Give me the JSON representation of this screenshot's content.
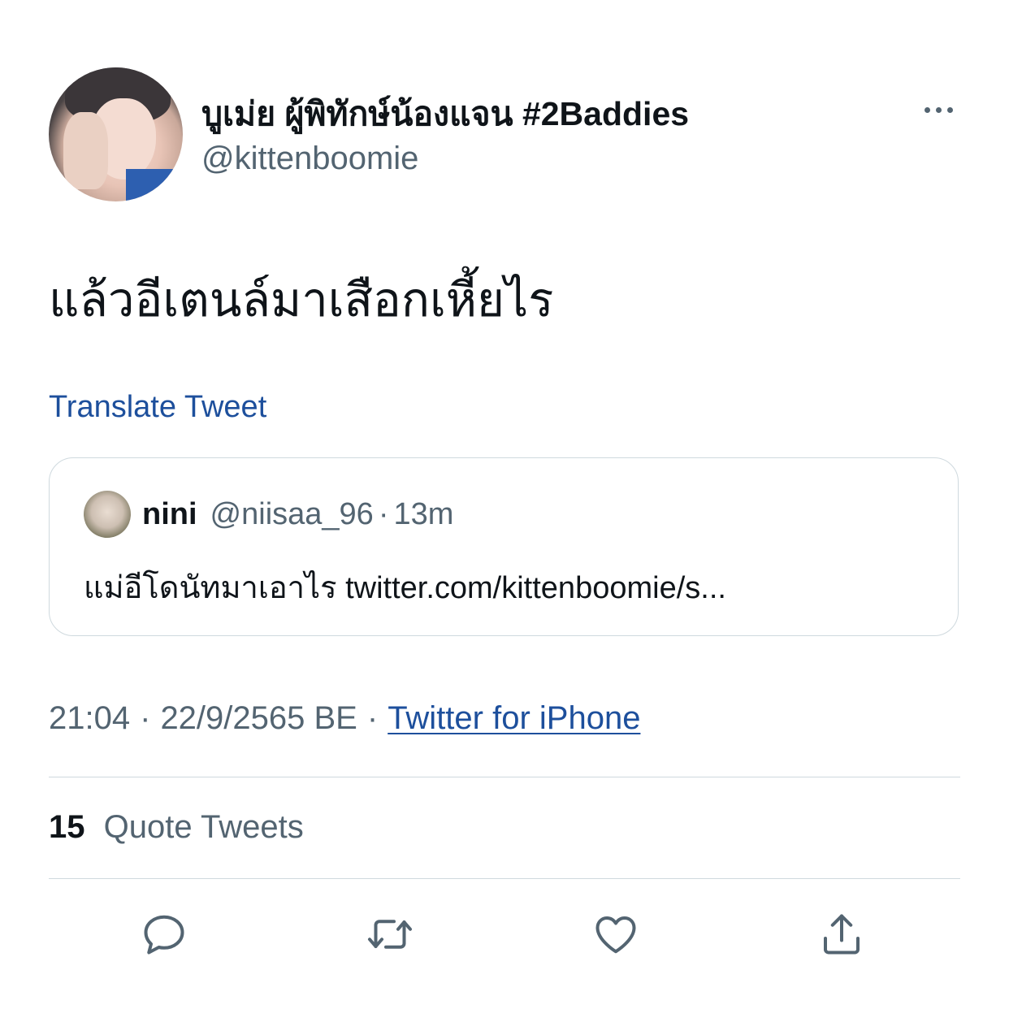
{
  "tweet": {
    "author": {
      "display_name": "บูเม่ย ผู้พิทักษ์น้องแจน #2Baddies",
      "handle": "@kittenboomie"
    },
    "text": "แล้วอีเตนล์มาเสือกเหี้ยไร",
    "translate_label": "Translate Tweet",
    "quoted": {
      "name": "nini",
      "handle": "@niisaa_96",
      "separator": "·",
      "time": "13m",
      "text": "แม่อีโดนัทมาเอาไร twitter.com/kittenboomie/s..."
    },
    "meta": {
      "time": "21:04",
      "separator": "·",
      "date": "22/9/2565 BE",
      "source": "Twitter for iPhone"
    },
    "stats": {
      "quote_count": "15",
      "quote_label": "Quote Tweets"
    }
  },
  "icons": {
    "more": "more-horizontal-icon",
    "reply": "reply-icon",
    "retweet": "retweet-icon",
    "like": "heart-icon",
    "share": "share-icon"
  },
  "colors": {
    "text": "#0f1419",
    "secondary": "#536471",
    "link": "#1d4f9c",
    "border": "#cfd9de"
  }
}
